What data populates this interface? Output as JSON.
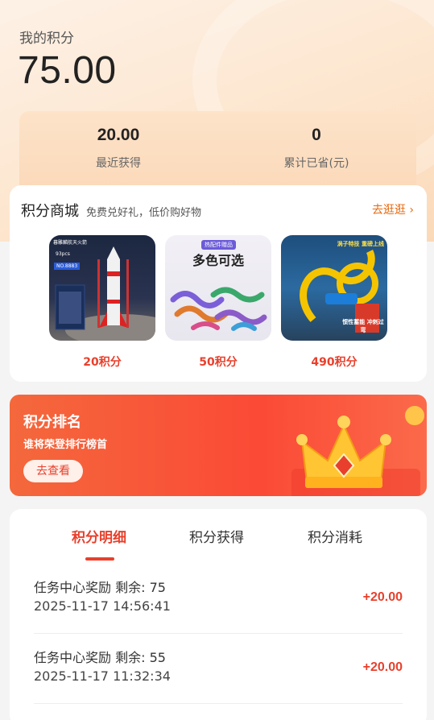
{
  "header": {
    "title": "我的积分",
    "total_points": "75.00"
  },
  "stats": [
    {
      "value": "20.00",
      "label": "最近获得"
    },
    {
      "value": "0",
      "label": "累计已省(元)"
    }
  ],
  "mall": {
    "title": "积分商城",
    "subtitle": "免费兑好礼，低价购好物",
    "more_label": "去逛逛",
    "products": [
      {
        "price": "20积分",
        "image_text_1": "暮雕麟航天火箭",
        "image_text_2": "93pcs",
        "image_text_3": "NO.8883"
      },
      {
        "price": "50积分",
        "image_text_1": "热配件赠品",
        "image_text_2": "多色可选"
      },
      {
        "price": "490积分",
        "image_text_1": "涡子特技 重磅上线",
        "image_text_2": "惯性蓄能 冲刺过弯"
      }
    ]
  },
  "ranking": {
    "title": "积分排名",
    "subtitle": "谁将荣登排行榜首",
    "button_label": "去查看"
  },
  "detail": {
    "tabs": [
      {
        "label": "积分明细",
        "active": true
      },
      {
        "label": "积分获得",
        "active": false
      },
      {
        "label": "积分消耗",
        "active": false
      }
    ],
    "records": [
      {
        "title": "任务中心奖励 剩余: 75",
        "time": "2025-11-17 14:56:41",
        "amount": "+20.00"
      },
      {
        "title": "任务中心奖励 剩余: 55",
        "time": "2025-11-17 11:32:34",
        "amount": "+20.00"
      }
    ]
  },
  "colors": {
    "accent": "#e8402c",
    "link": "#e66a10",
    "hero_bg": "#fde6cf"
  }
}
